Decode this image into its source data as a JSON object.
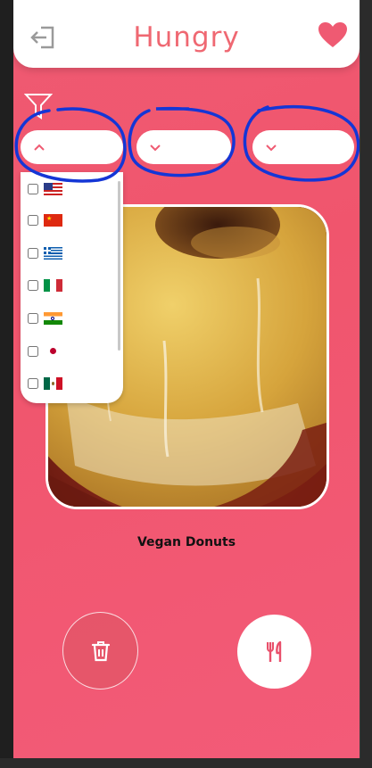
{
  "header": {
    "title": "Hungry",
    "logout_icon": "logout-icon",
    "favorites_icon": "heart-icon"
  },
  "filters": {
    "filter_icon": "funnel-icon",
    "dropdowns": [
      {
        "id": "cuisine",
        "state": "open",
        "chevron": "chevron-up-icon"
      },
      {
        "id": "second",
        "state": "closed",
        "chevron": "chevron-down-icon"
      },
      {
        "id": "third",
        "state": "closed",
        "chevron": "chevron-down-icon"
      }
    ],
    "cuisine_options": [
      {
        "flag": "us-flag-icon",
        "checked": false
      },
      {
        "flag": "china-flag-icon",
        "checked": false
      },
      {
        "flag": "greece-flag-icon",
        "checked": false
      },
      {
        "flag": "italy-flag-icon",
        "checked": false
      },
      {
        "flag": "india-flag-icon",
        "checked": false
      },
      {
        "flag": "japan-flag-icon",
        "checked": false
      },
      {
        "flag": "mexico-flag-icon",
        "checked": false
      }
    ]
  },
  "food": {
    "name": "Vegan Donuts",
    "image_icon": "donut-photo"
  },
  "actions": {
    "delete_icon": "trash-icon",
    "eat_icon": "fork-knife-icon"
  },
  "colors": {
    "accent": "#ef6872",
    "background": "#f0566e",
    "annotation": "#1436d6"
  }
}
